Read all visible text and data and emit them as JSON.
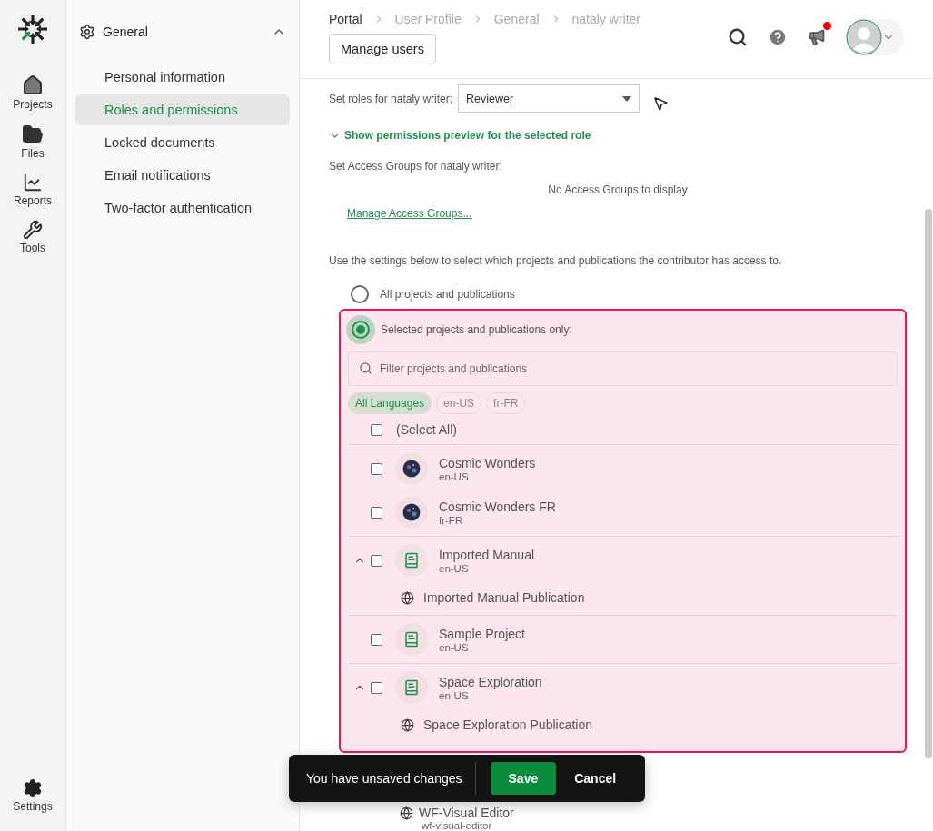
{
  "rail": {
    "items": [
      {
        "label": "Projects"
      },
      {
        "label": "Files"
      },
      {
        "label": "Reports"
      },
      {
        "label": "Tools"
      }
    ],
    "bottom": {
      "label": "Settings"
    }
  },
  "nav": {
    "section": {
      "label": "General",
      "expanded": true
    },
    "items": [
      {
        "label": "Personal information",
        "selected": false
      },
      {
        "label": "Roles and permissions",
        "selected": true
      },
      {
        "label": "Locked documents",
        "selected": false
      },
      {
        "label": "Email notifications",
        "selected": false
      },
      {
        "label": "Two-factor authentication",
        "selected": false
      }
    ]
  },
  "breadcrumb": [
    "Portal",
    "User Profile",
    "General",
    "nataly writer"
  ],
  "manage_users": "Manage users",
  "header": {
    "notification": true
  },
  "role": {
    "label": "Set roles for nataly writer:",
    "value": "Reviewer"
  },
  "permissions_link": {
    "label": "Show permissions preview for the selected role",
    "expanded": false
  },
  "access_groups": {
    "label": "Set Access Groups for nataly writer:",
    "empty": "No Access Groups to display",
    "link": "Manage Access Groups..."
  },
  "scope_text": "Use the settings below to select which projects and publications the contributor has access to.",
  "scope_options": [
    {
      "label": "All projects and publications",
      "selected": false
    },
    {
      "label": "Selected projects and publications only:",
      "selected": true
    }
  ],
  "filter": {
    "placeholder": "Filter projects and publications"
  },
  "languages": [
    {
      "label": "All Languages",
      "selected": true
    },
    {
      "label": "en-US",
      "selected": false
    },
    {
      "label": "fr-FR",
      "selected": false
    }
  ],
  "select_all": {
    "label": "(Select All)",
    "checked": false
  },
  "groups": [
    {
      "rows": [
        {
          "kind": "project",
          "name": "Cosmic Wonders",
          "lang": "en-US",
          "checked": false
        },
        {
          "kind": "project",
          "name": "Cosmic Wonders FR",
          "lang": "fr-FR",
          "checked": false
        }
      ]
    },
    {
      "rows": [
        {
          "kind": "project",
          "name": "Imported Manual",
          "lang": "en-US",
          "checked": false,
          "expanded": true
        },
        {
          "kind": "publication",
          "name": "Imported Manual Publication"
        }
      ]
    },
    {
      "rows": [
        {
          "kind": "project",
          "name": "Sample Project",
          "lang": "en-US",
          "checked": false
        }
      ]
    },
    {
      "rows": [
        {
          "kind": "project",
          "name": "Space Exploration",
          "lang": "en-US",
          "checked": false,
          "expanded": true
        },
        {
          "kind": "publication",
          "name": "Space Exploration Publication"
        }
      ]
    }
  ],
  "below": {
    "name": "WF-Visual Editor",
    "sub": "wf-visual-editor"
  },
  "toast": {
    "text": "You have unsaved changes",
    "save": "Save",
    "cancel": "Cancel"
  }
}
